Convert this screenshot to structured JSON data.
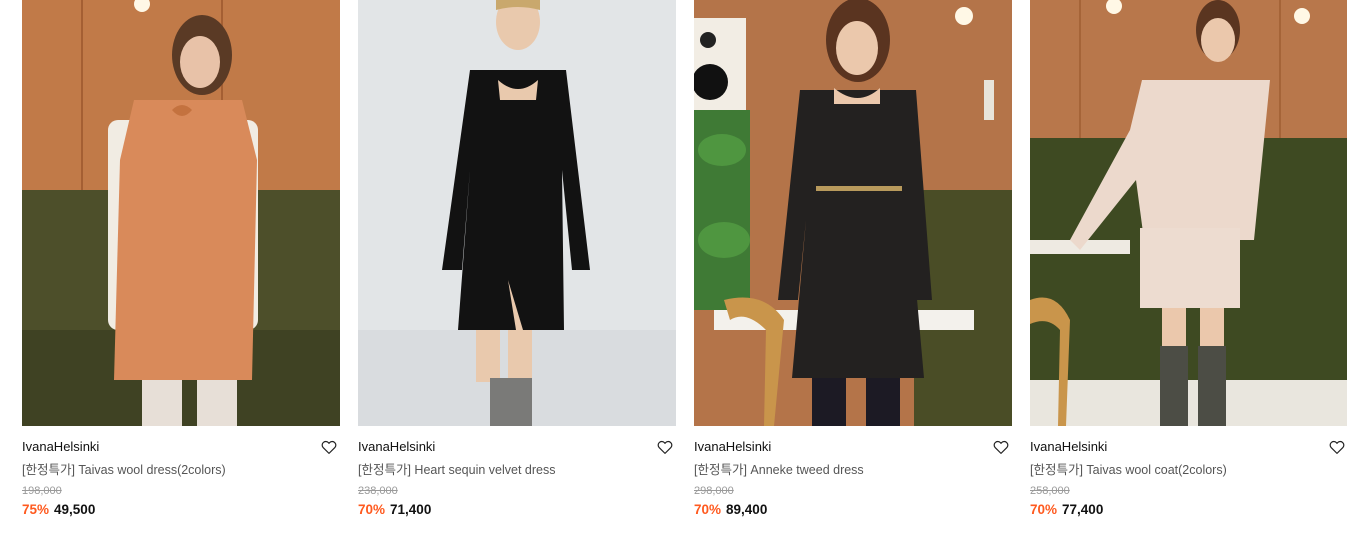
{
  "colors": {
    "accent_discount": "#ff5a1f",
    "text_primary": "#111111",
    "text_secondary": "#555555",
    "text_muted": "#9a9a9a"
  },
  "products": [
    {
      "brand": "IvanaHelsinki",
      "name": "[한정특가] Taivas wool dress(2colors)",
      "original_price": "198,000",
      "discount": "75%",
      "price": "49,500",
      "wishlist_icon": "heart-outline-icon"
    },
    {
      "brand": "IvanaHelsinki",
      "name": "[한정특가] Heart sequin velvet dress",
      "original_price": "238,000",
      "discount": "70%",
      "price": "71,400",
      "wishlist_icon": "heart-outline-icon"
    },
    {
      "brand": "IvanaHelsinki",
      "name": "[한정특가] Anneke tweed dress",
      "original_price": "298,000",
      "discount": "70%",
      "price": "89,400",
      "wishlist_icon": "heart-outline-icon"
    },
    {
      "brand": "IvanaHelsinki",
      "name": "[한정특가] Taivas wool coat(2colors)",
      "original_price": "258,000",
      "discount": "70%",
      "price": "77,400",
      "wishlist_icon": "heart-outline-icon"
    }
  ]
}
